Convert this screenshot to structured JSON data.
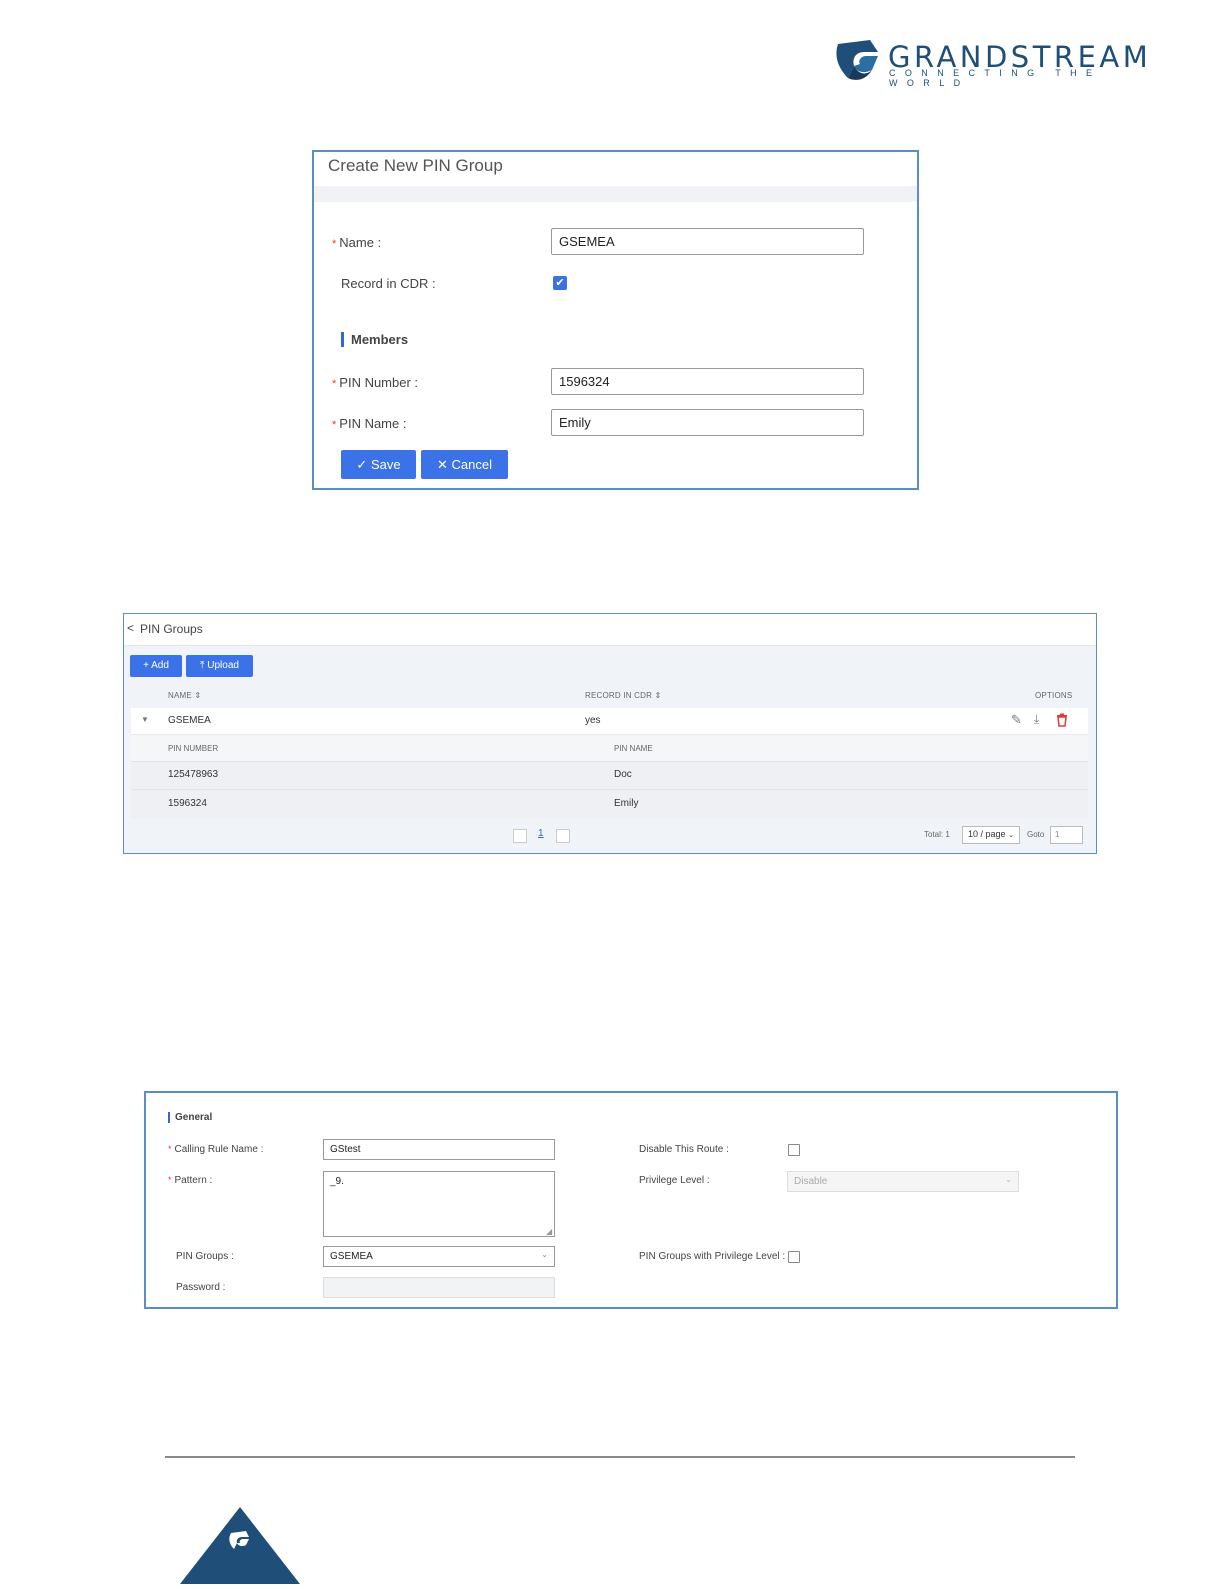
{
  "brand": {
    "name": "GRANDSTREAM",
    "tagline": "CONNECTING THE WORLD",
    "color": "#1f4f78"
  },
  "create_pin_group": {
    "title": "Create New PIN Group",
    "name_label": "Name",
    "name_value": "GSEMEA",
    "record_cdr_label": "Record in CDR",
    "record_cdr_checked": true,
    "members_section": "Members",
    "pin_number_label": "PIN Number",
    "pin_number_value": "1596324",
    "pin_name_label": "PIN Name",
    "pin_name_value": "Emily",
    "save_label": "Save",
    "cancel_label": "Cancel"
  },
  "pin_groups": {
    "title": "PIN Groups",
    "add_label": "Add",
    "upload_label": "Upload",
    "columns": {
      "name": "NAME",
      "record_in_cdr": "RECORD IN CDR",
      "options": "OPTIONS"
    },
    "group": {
      "name": "GSEMEA",
      "record_in_cdr": "yes"
    },
    "sub_columns": {
      "pin_number": "PIN NUMBER",
      "pin_name": "PIN NAME"
    },
    "members": [
      {
        "pin_number": "125478963",
        "pin_name": "Doc"
      },
      {
        "pin_number": "1596324",
        "pin_name": "Emily"
      }
    ],
    "pagination": {
      "current_page": "1",
      "total": "Total: 1",
      "page_size": "10 / page",
      "goto_label": "Goto",
      "goto_value": "1"
    }
  },
  "general": {
    "section": "General",
    "calling_rule_name_label": "Calling Rule Name",
    "calling_rule_name_value": "GStest",
    "pattern_label": "Pattern",
    "pattern_value": "_9.",
    "pin_groups_label": "PIN Groups",
    "pin_groups_value": "GSEMEA",
    "password_label": "Password",
    "disable_route_label": "Disable This Route",
    "privilege_level_label": "Privilege Level",
    "privilege_level_value": "Disable",
    "pin_groups_privilege_label": "PIN Groups with Privilege Level"
  },
  "accent_color": "#3b72e8"
}
